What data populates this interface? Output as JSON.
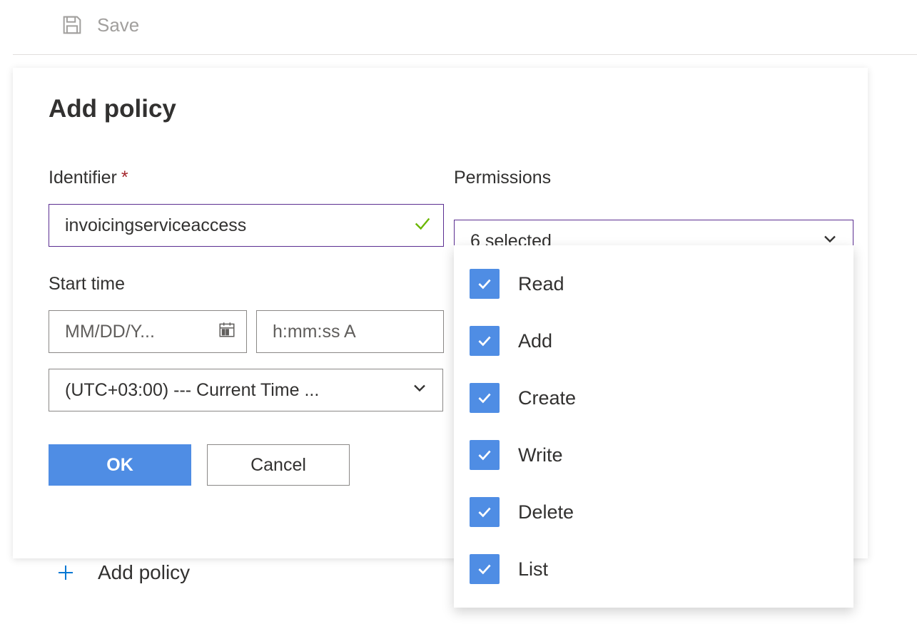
{
  "toolbar": {
    "save_label": "Save"
  },
  "panel": {
    "title": "Add policy"
  },
  "identifier": {
    "label": "Identifier",
    "value": "invoicingserviceaccess"
  },
  "start_time": {
    "label": "Start time",
    "date_placeholder": "MM/DD/Y...",
    "time_placeholder": "h:mm:ss A",
    "timezone": "(UTC+03:00) --- Current Time ..."
  },
  "permissions": {
    "label": "Permissions",
    "summary": "6 selected",
    "options": [
      {
        "label": "Read",
        "checked": true
      },
      {
        "label": "Add",
        "checked": true
      },
      {
        "label": "Create",
        "checked": true
      },
      {
        "label": "Write",
        "checked": true
      },
      {
        "label": "Delete",
        "checked": true
      },
      {
        "label": "List",
        "checked": true
      }
    ]
  },
  "actions": {
    "ok": "OK",
    "cancel": "Cancel"
  },
  "behind": {
    "add_policy": "Add policy"
  }
}
